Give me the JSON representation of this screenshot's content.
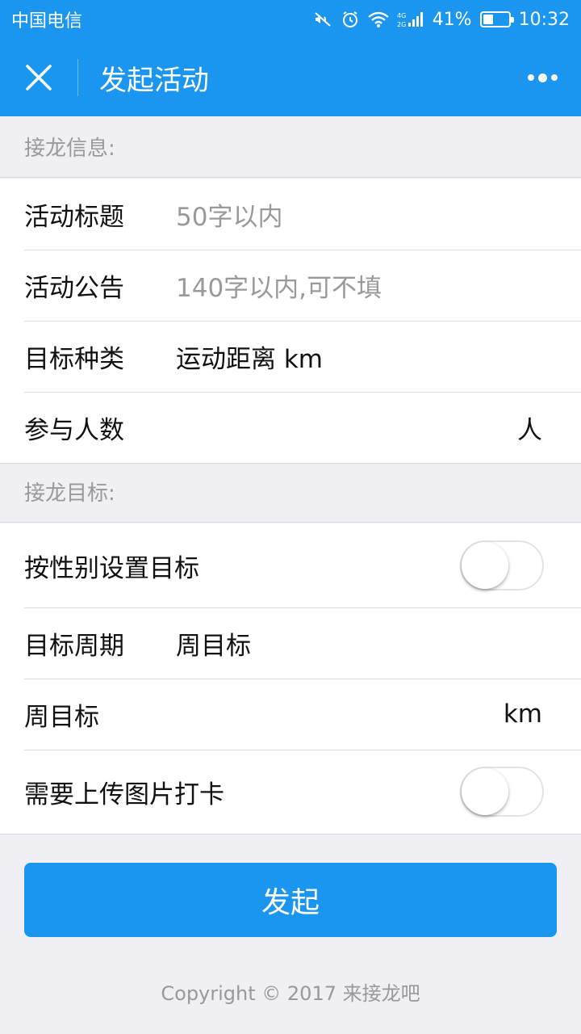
{
  "status_bar": {
    "carrier": "中国电信",
    "network": "4G 2G",
    "battery_percent": "41%",
    "battery_level": 0.41,
    "time": "10:32",
    "icons": [
      "mute-icon",
      "alarm-icon",
      "wifi-icon",
      "signal-icon",
      "battery-icon"
    ]
  },
  "nav": {
    "close_icon": "close-icon",
    "title": "发起活动",
    "more_icon": "more-icon"
  },
  "info_section": {
    "header": "接龙信息:",
    "title_label": "活动标题",
    "title_placeholder": "50字以内",
    "notice_label": "活动公告",
    "notice_placeholder": "140字以内,可不填",
    "target_type_label": "目标种类",
    "target_type_value": "运动距离 km",
    "participants_label": "参与人数",
    "participants_unit": "人"
  },
  "target_section": {
    "header": "接龙目标:",
    "gender_label": "按性别设置目标",
    "gender_toggle_on": false,
    "period_label": "目标周期",
    "period_value": "周目标",
    "weekly_label": "周目标",
    "weekly_unit": "km",
    "photo_label": "需要上传图片打卡",
    "photo_toggle_on": false
  },
  "submit_label": "发起",
  "copyright": "Copyright © 2017 来接龙吧",
  "colors": {
    "primary": "#1a96f0",
    "background": "#efeff4"
  }
}
